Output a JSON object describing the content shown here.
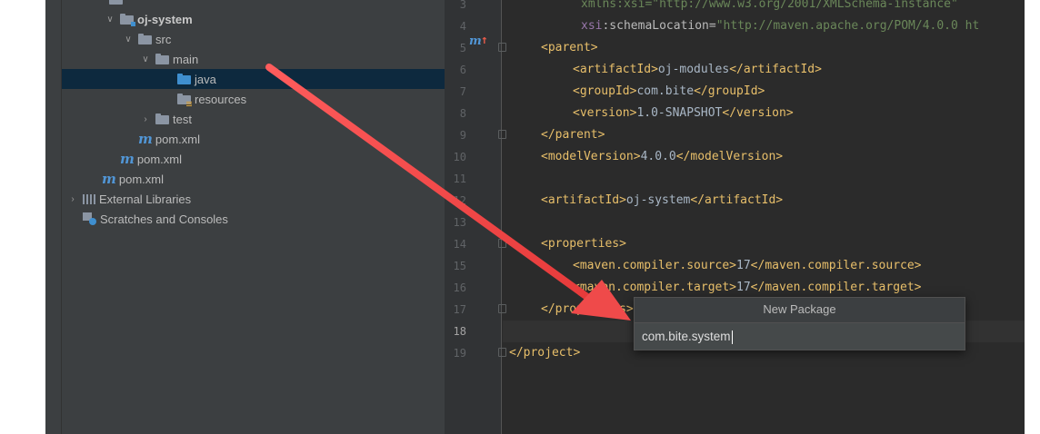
{
  "project_tree": {
    "items": [
      {
        "label": "oj-system",
        "icon": "module-folder-icon",
        "chevron": "expanded",
        "bold": true
      },
      {
        "label": "src",
        "icon": "folder-icon",
        "chevron": "expanded"
      },
      {
        "label": "main",
        "icon": "folder-icon",
        "chevron": "expanded"
      },
      {
        "label": "java",
        "icon": "source-folder-icon",
        "chevron": "",
        "selected": true
      },
      {
        "label": "resources",
        "icon": "resources-folder-icon",
        "chevron": ""
      },
      {
        "label": "test",
        "icon": "folder-icon",
        "chevron": "collapsed"
      },
      {
        "label": "pom.xml",
        "icon": "maven-icon",
        "chevron": ""
      },
      {
        "label": "pom.xml",
        "icon": "maven-icon",
        "chevron": ""
      },
      {
        "label": "pom.xml",
        "icon": "maven-icon",
        "chevron": ""
      },
      {
        "label": "External Libraries",
        "icon": "library-icon",
        "chevron": "collapsed"
      },
      {
        "label": "Scratches and Consoles",
        "icon": "scratches-icon",
        "chevron": ""
      }
    ]
  },
  "editor": {
    "current_line": "18",
    "line_numbers": [
      "3",
      "4",
      "5",
      "6",
      "7",
      "8",
      "9",
      "10",
      "11",
      "12",
      "13",
      "14",
      "15",
      "16",
      "17",
      "18",
      "19"
    ],
    "code": {
      "l3_partial": "xmlns:xsi=\"http://www.w3.org/2001/XMLSchema-instance\"",
      "l4_attr_ns": "xsi",
      "l4_attr": ":schemaLocation=",
      "l4_val": "\"http://maven.apache.org/POM/4.0.0 ht",
      "l5": "<parent>",
      "l6_open": "<artifactId>",
      "l6_text": "oj-modules",
      "l6_close": "</artifactId>",
      "l7_open": "<groupId>",
      "l7_text": "com.bite",
      "l7_close": "</groupId>",
      "l8_open": "<version>",
      "l8_text": "1.0-SNAPSHOT",
      "l8_close": "</version>",
      "l9": "</parent>",
      "l10_open": "<modelVersion>",
      "l10_text": "4.0.0",
      "l10_close": "</modelVersion>",
      "l12_open": "<artifactId>",
      "l12_text": "oj-system",
      "l12_close": "</artifactId>",
      "l14": "<properties>",
      "l15_open": "<maven.compiler.source>",
      "l15_text": "17",
      "l15_close": "</maven.compiler.source>",
      "l16_open": "<maven.compiler.target>",
      "l16_text": "17",
      "l16_close": "</maven.compiler.target>",
      "l17": "</properties>",
      "l19": "</project>"
    }
  },
  "new_package_dialog": {
    "title": "New Package",
    "value": "com.bite.system"
  },
  "colors": {
    "arrow": "#ef4a4a",
    "selection": "#0d293e",
    "tag": "#e8bf6a"
  }
}
